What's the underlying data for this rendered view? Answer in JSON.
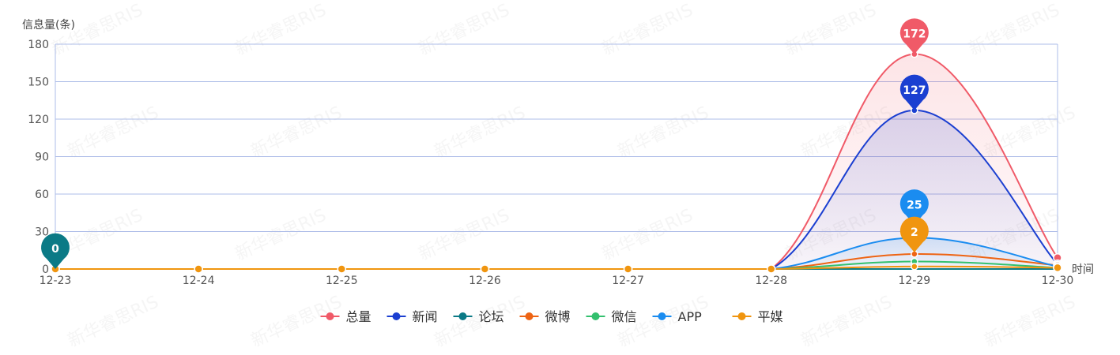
{
  "chart_data": {
    "type": "line",
    "ylabel": "信息量(条)",
    "xlabel": "时间",
    "ylim": [
      0,
      180
    ],
    "yticks": [
      0,
      30,
      60,
      90,
      120,
      150,
      180
    ],
    "categories": [
      "12-23",
      "12-24",
      "12-25",
      "12-26",
      "12-27",
      "12-28",
      "12-29",
      "12-30"
    ],
    "grid": true,
    "legend_position": "bottom",
    "watermark_text": "新华睿思RIS",
    "series": [
      {
        "name": "总量",
        "color": "#f05a68",
        "values": [
          0,
          0,
          0,
          0,
          0,
          0,
          172,
          9
        ],
        "area": true,
        "pin": {
          "index": 6,
          "text": "172"
        }
      },
      {
        "name": "新闻",
        "color": "#1b3fd1",
        "values": [
          0,
          0,
          0,
          0,
          0,
          0,
          127,
          4
        ],
        "area": true,
        "pin": {
          "index": 6,
          "text": "127"
        }
      },
      {
        "name": "论坛",
        "color": "#0b7a86",
        "values": [
          0,
          0,
          0,
          0,
          0,
          0,
          0,
          0
        ],
        "area": false,
        "pin": {
          "index": 0,
          "text": "0"
        }
      },
      {
        "name": "微博",
        "color": "#ee6414",
        "values": [
          0,
          0,
          0,
          0,
          0,
          0,
          12,
          3
        ],
        "area": false
      },
      {
        "name": "微信",
        "color": "#33c06e",
        "values": [
          0,
          0,
          0,
          0,
          0,
          0,
          6,
          1
        ],
        "area": false
      },
      {
        "name": "APP",
        "color": "#1a8cf0",
        "values": [
          0,
          0,
          0,
          0,
          0,
          0,
          25,
          2
        ],
        "area": true,
        "pin": {
          "index": 6,
          "text": "25"
        }
      },
      {
        "name": "平媒",
        "color": "#f0950f",
        "values": [
          0,
          0,
          0,
          0,
          0,
          0,
          2,
          1
        ],
        "area": false,
        "pin": {
          "index": 6,
          "text": "2"
        }
      }
    ]
  }
}
